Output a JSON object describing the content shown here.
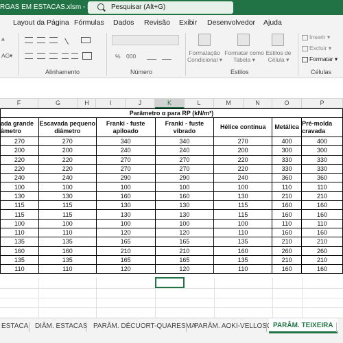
{
  "titlebar": {
    "file_name": "RGAS EM ESTACAS.xlsm  -  Excel",
    "search_placeholder": "Pesquisar (Alt+G)"
  },
  "menu": [
    "Layout da Página",
    "Fórmulas",
    "Dados",
    "Revisão",
    "Exibir",
    "Desenvolvedor",
    "Ajuda"
  ],
  "ribbon": {
    "groups": {
      "alinhamento": "Alinhamento",
      "numero": "Número",
      "estilos": "Estilos",
      "celulas": "Células"
    },
    "formatacao_condicional": [
      "Formatação",
      "Condicional ▾"
    ],
    "formatar_como_tabela": [
      "Formatar como",
      "Tabela ▾"
    ],
    "estilos_de_celula": [
      "Estilos de",
      "Célula ▾"
    ],
    "inserir": "Inserir ▾",
    "excluir": "Excluir ▾",
    "formatar": "Formatar ▾",
    "percent_symbol": "%",
    "thousands_symbol": "000",
    "left_cut_symbol": "AG",
    "left_cut_arrow": "▾",
    "left_cut_line": "a"
  },
  "columns": [
    "F",
    "G",
    "H",
    "I",
    "J",
    "K",
    "L",
    "M",
    "N",
    "O",
    "P"
  ],
  "selected_column": "K",
  "table": {
    "title": "Parâmetro α para RP (kN/m²)",
    "headers": [
      "ada grande\nâmetro",
      "Escavada pequeno\ndiâmetro",
      "Franki - fuste\napiloado",
      "Franki - fuste\nvibrado",
      "Hélice contínua",
      "Metálica",
      "Pré-molda\ncravada"
    ],
    "rows": [
      [
        "270",
        "270",
        "340",
        "340",
        "270",
        "400",
        "400"
      ],
      [
        "200",
        "200",
        "240",
        "240",
        "200",
        "300",
        "300"
      ],
      [
        "220",
        "220",
        "270",
        "270",
        "220",
        "330",
        "330"
      ],
      [
        "220",
        "220",
        "270",
        "270",
        "220",
        "330",
        "330"
      ],
      [
        "240",
        "240",
        "290",
        "290",
        "240",
        "360",
        "360"
      ],
      [
        "100",
        "100",
        "100",
        "100",
        "100",
        "110",
        "110"
      ],
      [
        "130",
        "130",
        "160",
        "160",
        "130",
        "210",
        "210"
      ],
      [
        "115",
        "115",
        "130",
        "130",
        "115",
        "160",
        "160"
      ],
      [
        "115",
        "115",
        "130",
        "130",
        "115",
        "160",
        "160"
      ],
      [
        "100",
        "100",
        "100",
        "100",
        "100",
        "110",
        "110"
      ],
      [
        "110",
        "110",
        "120",
        "120",
        "110",
        "160",
        "160"
      ],
      [
        "135",
        "135",
        "165",
        "165",
        "135",
        "210",
        "210"
      ],
      [
        "160",
        "160",
        "210",
        "210",
        "160",
        "260",
        "260"
      ],
      [
        "135",
        "135",
        "165",
        "165",
        "135",
        "210",
        "210"
      ],
      [
        "110",
        "110",
        "120",
        "120",
        "110",
        "160",
        "160"
      ]
    ]
  },
  "sheet_tabs": [
    "ESTACA",
    "DIÂM. ESTACAS",
    "PARÂM. DÉCUORT-QUARESMA",
    "PARÂM. AOKI-VELLOSO",
    "PARÂM. TEIXEIRA"
  ],
  "active_tab": "PARÂM. TEIXEIRA"
}
